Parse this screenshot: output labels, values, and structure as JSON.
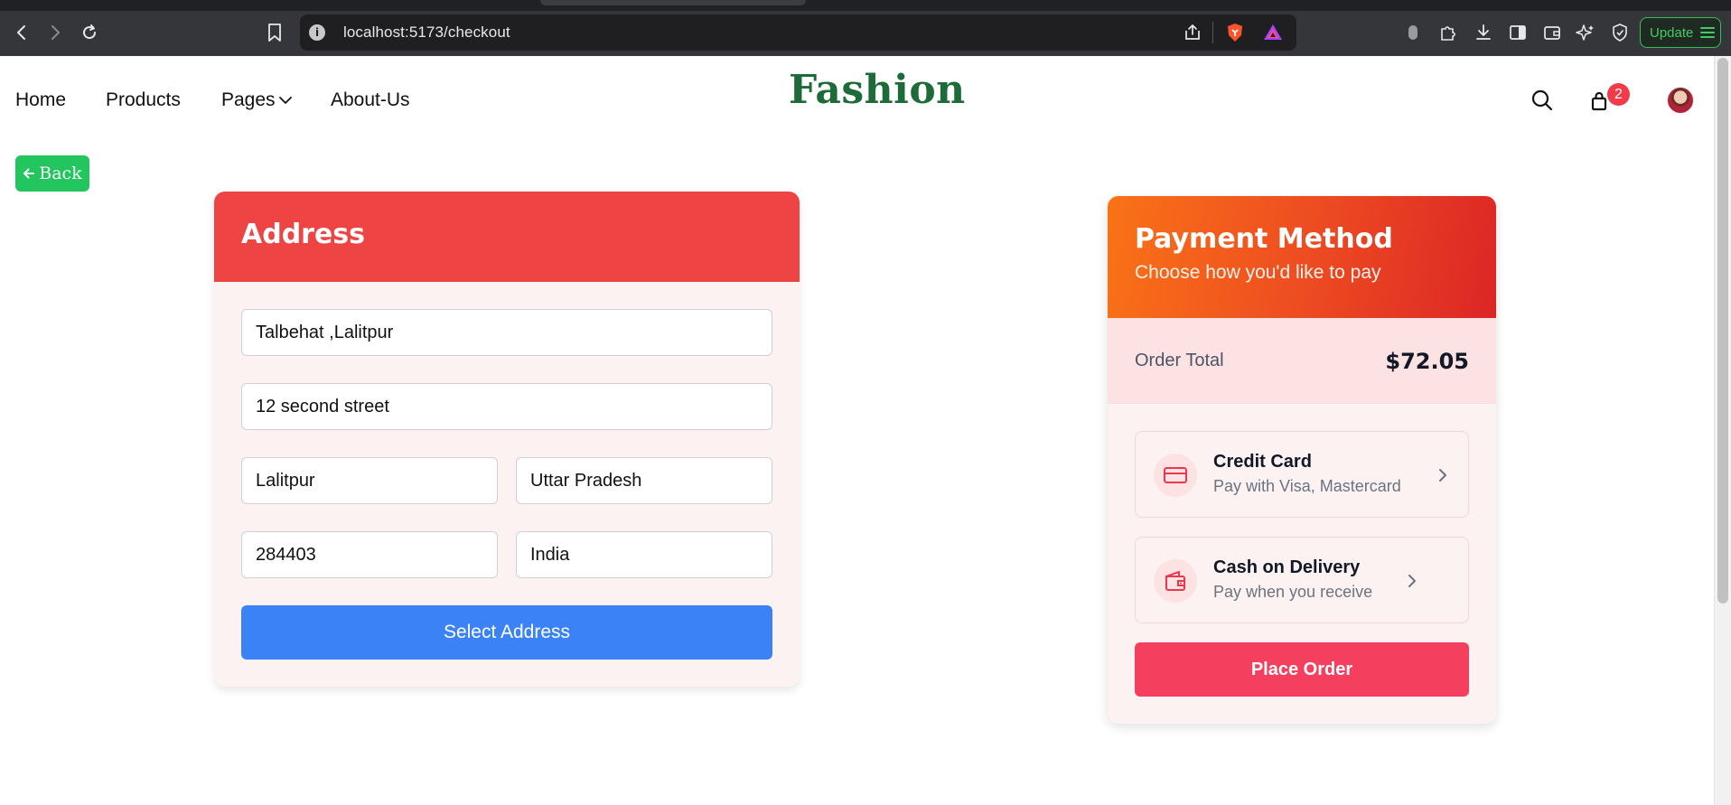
{
  "browser": {
    "url": "localhost:5173/checkout",
    "update_label": "Update",
    "accent_update": "#46c964"
  },
  "header": {
    "nav": [
      {
        "label": "Home"
      },
      {
        "label": "Products"
      },
      {
        "label": "Pages"
      },
      {
        "label": "About-Us"
      }
    ],
    "brand": "Fashion",
    "brand_color": "#1e6b3a",
    "cart_count": "2"
  },
  "back_button": {
    "label": "Back"
  },
  "address": {
    "title": "Address",
    "accent": "#ef4444",
    "fields": {
      "line1": "Talbehat ,Lalitpur",
      "line2": "12 second street",
      "city": "Lalitpur",
      "state": "Uttar Pradesh",
      "pincode": "284403",
      "country": "India"
    },
    "select_label": "Select Address"
  },
  "payment": {
    "title": "Payment Method",
    "subtitle": "Choose how you'd like to pay",
    "order_total_label": "Order Total",
    "order_total_value": "$72.05",
    "methods": [
      {
        "title": "Credit Card",
        "subtitle": "Pay with Visa, Mastercard",
        "icon": "credit-card-icon"
      },
      {
        "title": "Cash on Delivery",
        "subtitle": "Pay when you receive",
        "icon": "wallet-icon"
      }
    ],
    "place_order_label": "Place Order",
    "accent": "#f43f5e"
  }
}
